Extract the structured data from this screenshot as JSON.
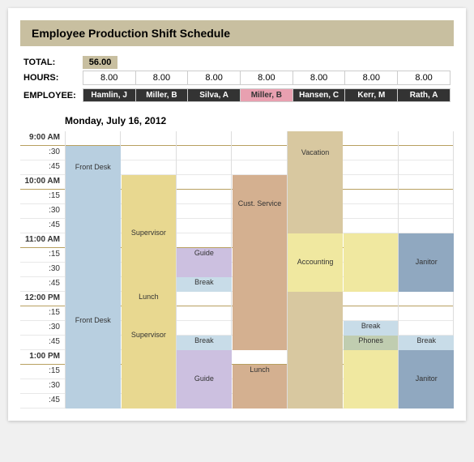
{
  "title": "Employee Production Shift Schedule",
  "summary": {
    "total_label": "TOTAL:",
    "total_value": "56.00",
    "hours_label": "HOURS:",
    "employee_label": "EMPLOYEE:",
    "employees": [
      {
        "name": "Hamlin, J",
        "hours": "8.00",
        "highlight": false
      },
      {
        "name": "Miller, B",
        "hours": "8.00",
        "highlight": false
      },
      {
        "name": "Silva, A",
        "hours": "8.00",
        "highlight": false
      },
      {
        "name": "Miller, B",
        "hours": "8.00",
        "highlight": true
      },
      {
        "name": "Hansen, C",
        "hours": "8.00",
        "highlight": false
      },
      {
        "name": "Kerr, M",
        "hours": "8.00",
        "highlight": false
      },
      {
        "name": "Rath, A",
        "hours": "8.00",
        "highlight": false
      }
    ]
  },
  "date_header": "Monday, July 16, 2012",
  "times": [
    "9:00 AM",
    ":30",
    ":45",
    "10:00 AM",
    ":15",
    ":30",
    ":45",
    "11:00 AM",
    ":15",
    ":30",
    ":45",
    "12:00 PM",
    ":15",
    ":30",
    ":45",
    "1:00 PM",
    ":15",
    ":30",
    ":45"
  ],
  "blocks": {
    "front_desk_1": "Front Desk",
    "supervisor_1": "Supervisor",
    "cust_service": "Cust. Service",
    "vacation": "Vacation",
    "accounting": "Accounting",
    "janitor_1": "Janitor",
    "guide_1": "Guide",
    "break_1": "Break",
    "lunch_1": "Lunch",
    "supervisor_2": "Supervisor",
    "front_desk_2": "Front Desk",
    "break_2": "Break",
    "break_phones": "Phones",
    "break_3": "Break",
    "guide_2": "Guide",
    "janitor_2": "Janitor",
    "lunch_2": "Lunch",
    "break_4": "Break"
  }
}
